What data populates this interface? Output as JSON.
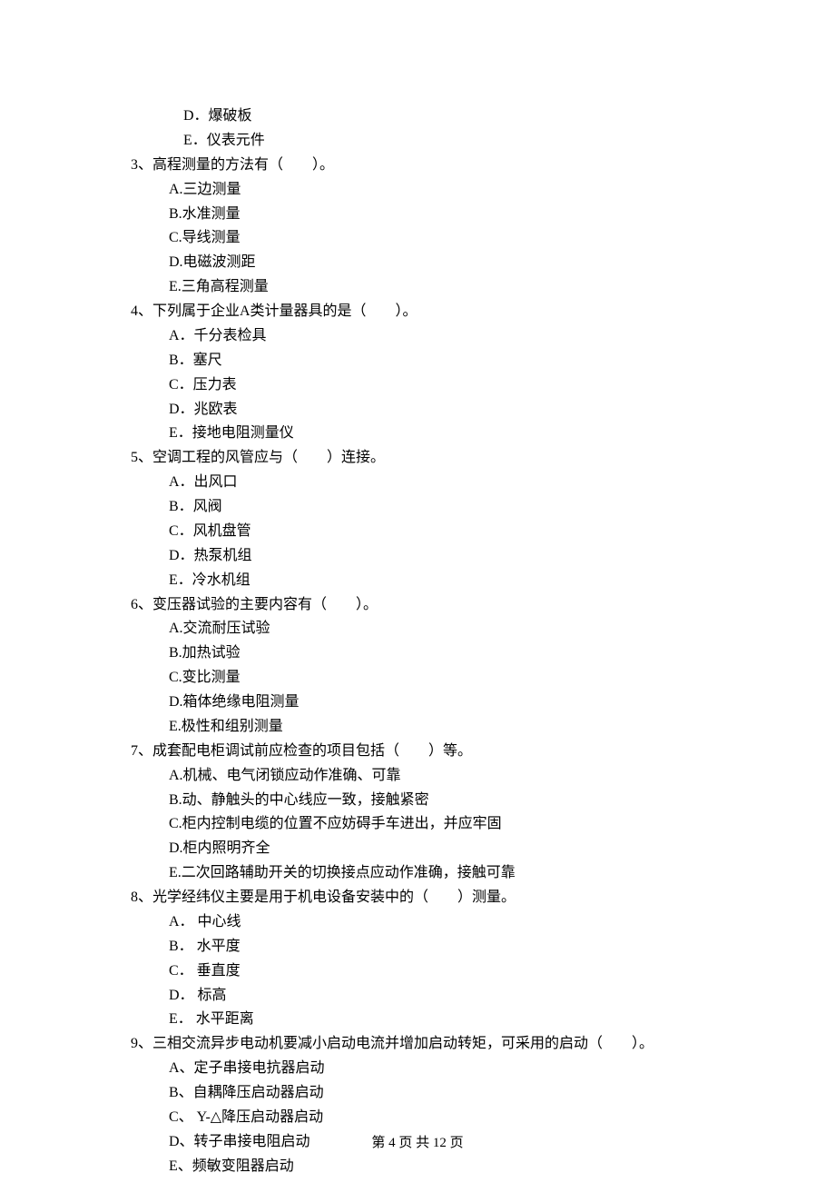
{
  "q2_opts_tail": {
    "d": "D．爆破板",
    "e": "E．仪表元件"
  },
  "q3": {
    "stem": "3、高程测量的方法有（　　）。",
    "a": "A.三边测量",
    "b": "B.水准测量",
    "c": "C.导线测量",
    "d": "D.电磁波测距",
    "e": "E.三角高程测量"
  },
  "q4": {
    "stem": "4、下列属于企业A类计量器具的是（　　）。",
    "a": "A．千分表检具",
    "b": "B．塞尺",
    "c": "C．压力表",
    "d": "D．兆欧表",
    "e": "E．接地电阻测量仪"
  },
  "q5": {
    "stem": "5、空调工程的风管应与（　　）连接。",
    "a": "A．出风口",
    "b": "B．风阀",
    "c": "C．风机盘管",
    "d": "D．热泵机组",
    "e": "E．冷水机组"
  },
  "q6": {
    "stem": "6、变压器试验的主要内容有（　　）。",
    "a": "A.交流耐压试验",
    "b": "B.加热试验",
    "c": "C.变比测量",
    "d": "D.箱体绝缘电阻测量",
    "e": "E.极性和组别测量"
  },
  "q7": {
    "stem": "7、成套配电柜调试前应检查的项目包括（　　）等。",
    "a": "A.机械、电气闭锁应动作准确、可靠",
    "b": "B.动、静触头的中心线应一致，接触紧密",
    "c": "C.柜内控制电缆的位置不应妨碍手车进出，并应牢固",
    "d": "D.柜内照明齐全",
    "e": "E.二次回路辅助开关的切换接点应动作准确，接触可靠"
  },
  "q8": {
    "stem": "8、光学经纬仪主要是用于机电设备安装中的（　　）测量。",
    "a": "A． 中心线",
    "b": "B． 水平度",
    "c": "C． 垂直度",
    "d": "D． 标高",
    "e": "E． 水平距离"
  },
  "q9": {
    "stem": "9、三相交流异步电动机要减小启动电流并增加启动转矩，可采用的启动（　　）。",
    "a": "A、定子串接电抗器启动",
    "b": "B、自耦降压启动器启动",
    "c": "C、 Y-△降压启动器启动",
    "d": "D、转子串接电阻启动",
    "e": "E、频敏变阻器启动"
  },
  "footer": "第 4 页 共 12 页"
}
